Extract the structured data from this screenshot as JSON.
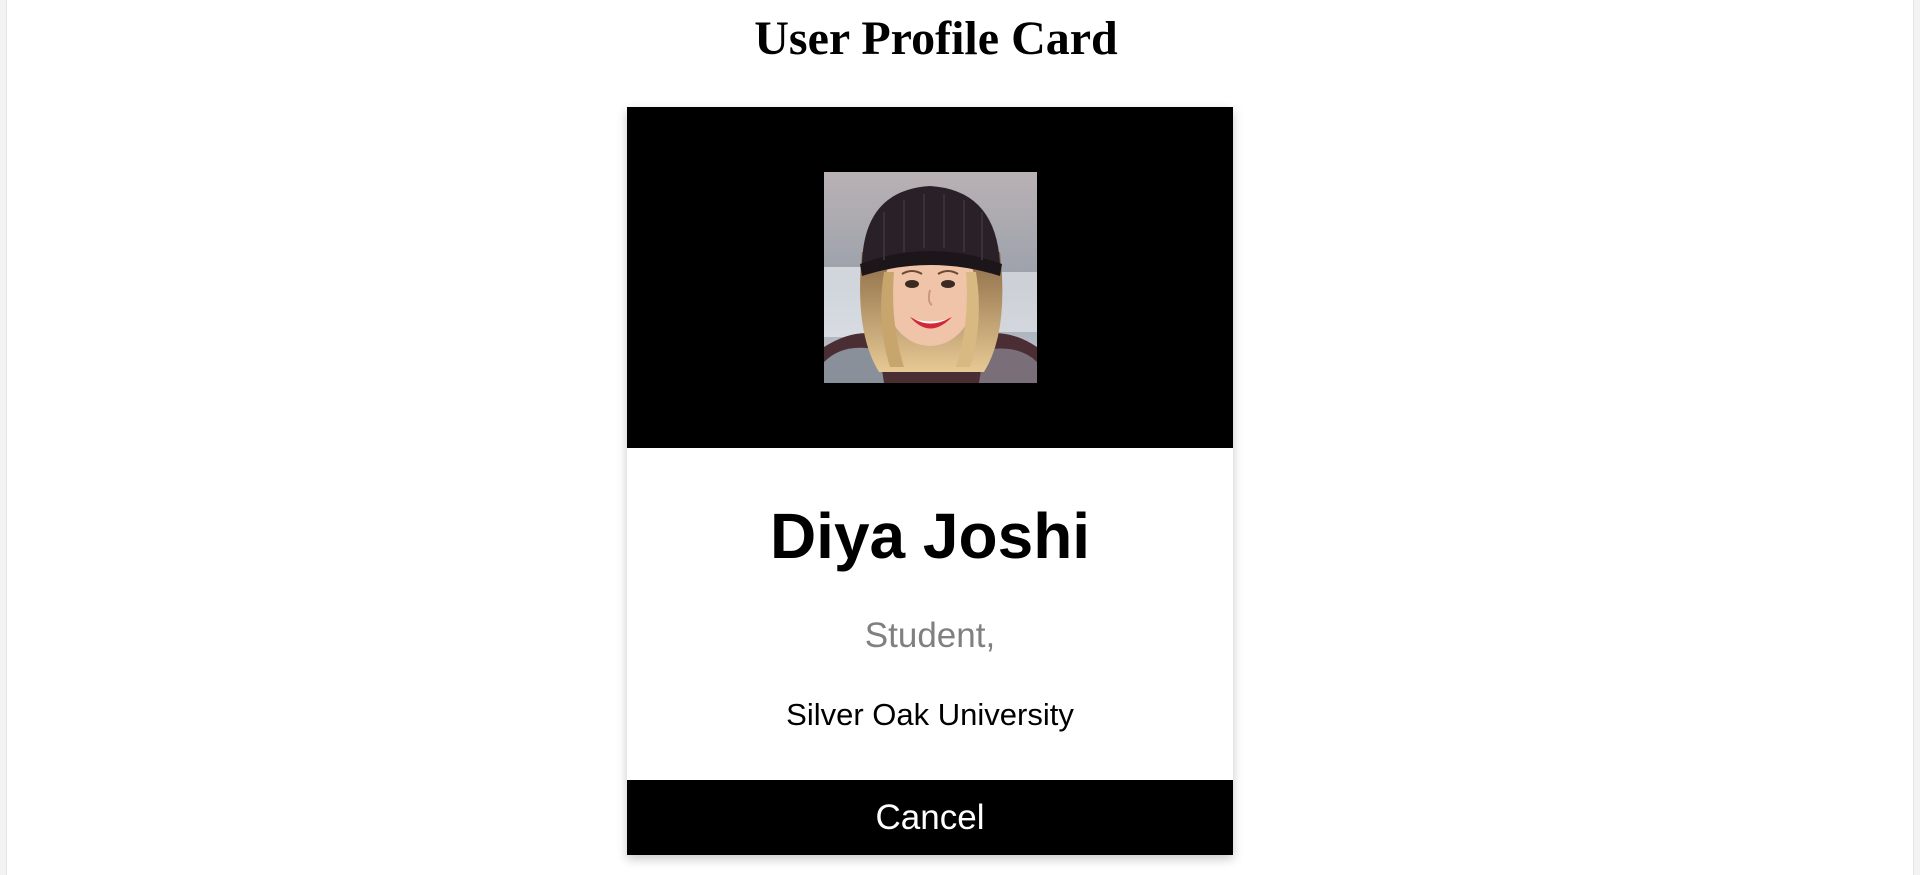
{
  "page": {
    "title": "User Profile Card"
  },
  "profile": {
    "photo": "profile-photo",
    "name": "Diya Joshi",
    "role": "Student,",
    "organization": "Silver Oak University"
  },
  "actions": {
    "cancel_label": "Cancel"
  },
  "colors": {
    "header_background": "#000000",
    "button_background": "#000000",
    "button_text": "#ffffff",
    "role_text": "#808080"
  }
}
